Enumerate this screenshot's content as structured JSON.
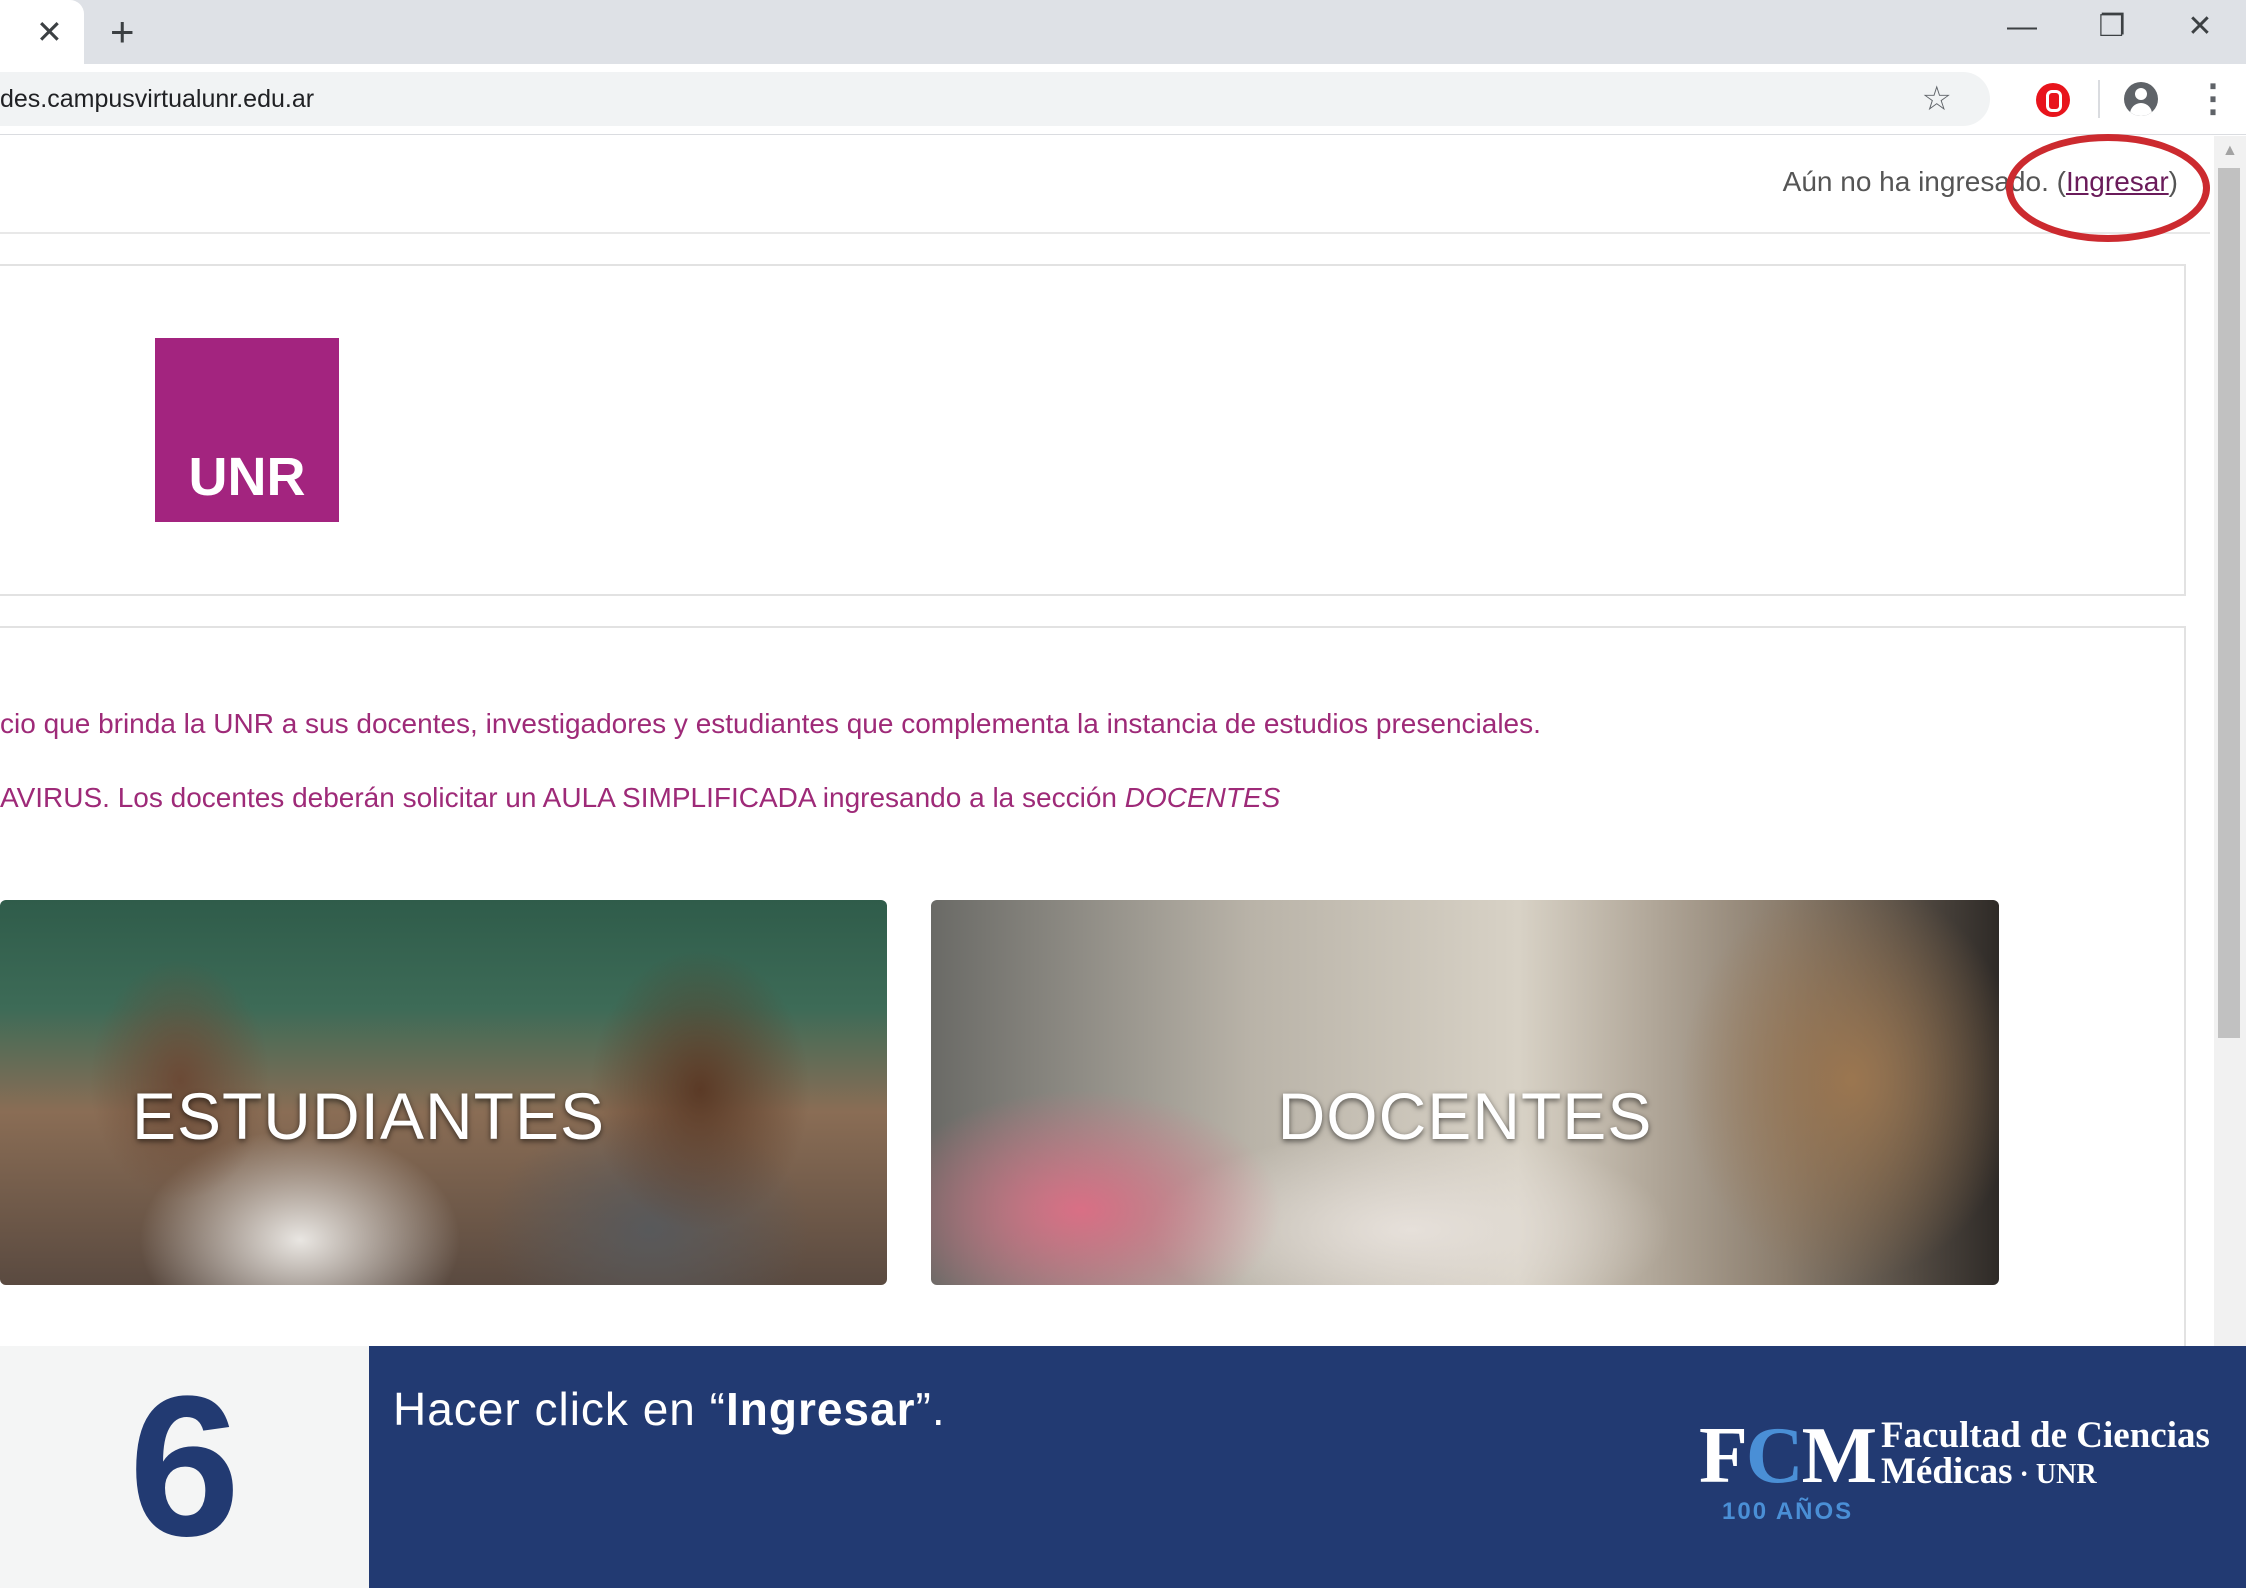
{
  "browser": {
    "tab_close": "✕",
    "new_tab": "+",
    "url": "des.campusvirtualunr.edu.ar",
    "minimize": "—",
    "restore": "❐",
    "close": "✕",
    "star": "☆",
    "menu": "⋮"
  },
  "page": {
    "login_prefix": "Aún no ha ingresado. (",
    "login_link": "Ingresar",
    "login_suffix": ")",
    "logo_text": "UNR",
    "intro_line1": "cio que brinda la UNR a sus docentes, investigadores y estudiantes que complementa la instancia de estudios presenciales.",
    "intro_line2": "AVIRUS. Los docentes deberán solicitar un AULA SIMPLIFICADA ingresando a la sección ",
    "intro_line2_em": "DOCENTES",
    "cards": [
      {
        "label": "ESTUDIANTES"
      },
      {
        "label": "DOCENTES"
      }
    ]
  },
  "instruction": {
    "step": "6",
    "text_before": "Hacer click en “",
    "text_bold": "Ingresar",
    "text_after": "”.",
    "brand_letters_1": "F",
    "brand_letters_2": "C",
    "brand_letters_3": "M",
    "brand_line1": "Facultad de Ciencias",
    "brand_line2": "Médicas",
    "brand_line2_sep": " · ",
    "brand_line2_unr": "UNR",
    "brand_years": "100 AÑOS"
  },
  "colors": {
    "unr_magenta": "#a3247f",
    "intro_text": "#9e2a78",
    "highlight_circle": "#cc2a2f",
    "banner_blue": "#223a72"
  }
}
